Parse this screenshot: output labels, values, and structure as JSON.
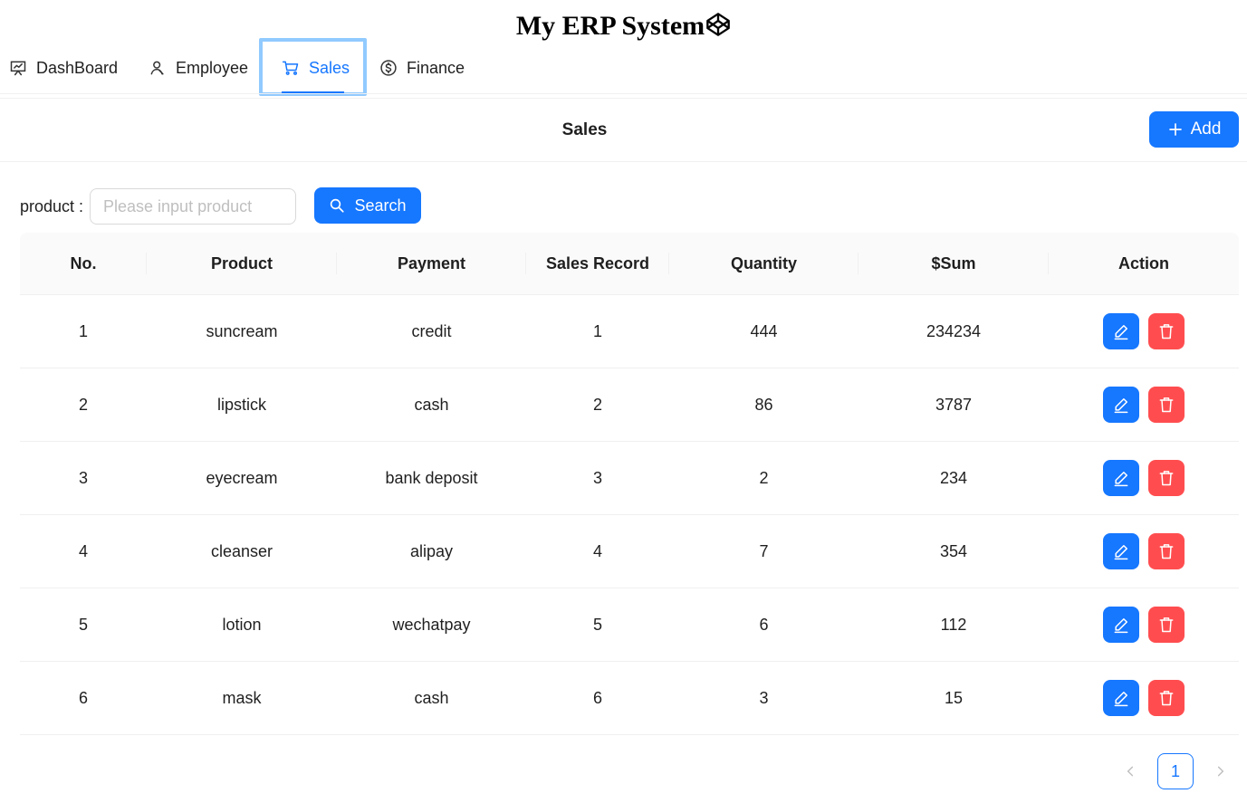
{
  "app": {
    "title": "My ERP System"
  },
  "nav": {
    "items": [
      {
        "label": "DashBoard",
        "icon": "dashboard-icon"
      },
      {
        "label": "Employee",
        "icon": "employee-icon"
      },
      {
        "label": "Sales",
        "icon": "cart-icon",
        "active": true
      },
      {
        "label": "Finance",
        "icon": "dollar-icon"
      }
    ]
  },
  "page": {
    "title": "Sales",
    "add_label": "Add"
  },
  "search": {
    "label": "product",
    "placeholder": "Please input product",
    "button_label": "Search"
  },
  "table": {
    "columns": [
      "No.",
      "Product",
      "Payment",
      "Sales Record",
      "Quantity",
      "$Sum",
      "Action"
    ],
    "rows": [
      [
        "1",
        "suncream",
        "credit",
        "1",
        "444",
        "234234"
      ],
      [
        "2",
        "lipstick",
        "cash",
        "2",
        "86",
        "3787"
      ],
      [
        "3",
        "eyecream",
        "bank deposit",
        "3",
        "2",
        "234"
      ],
      [
        "4",
        "cleanser",
        "alipay",
        "4",
        "7",
        "354"
      ],
      [
        "5",
        "lotion",
        "wechatpay",
        "5",
        "6",
        "112"
      ],
      [
        "6",
        "mask",
        "cash",
        "6",
        "3",
        "15"
      ]
    ]
  },
  "pagination": {
    "current": "1"
  },
  "colors": {
    "primary": "#1677ff",
    "danger": "#ff4d4f",
    "focus_ring": "#91caff"
  }
}
